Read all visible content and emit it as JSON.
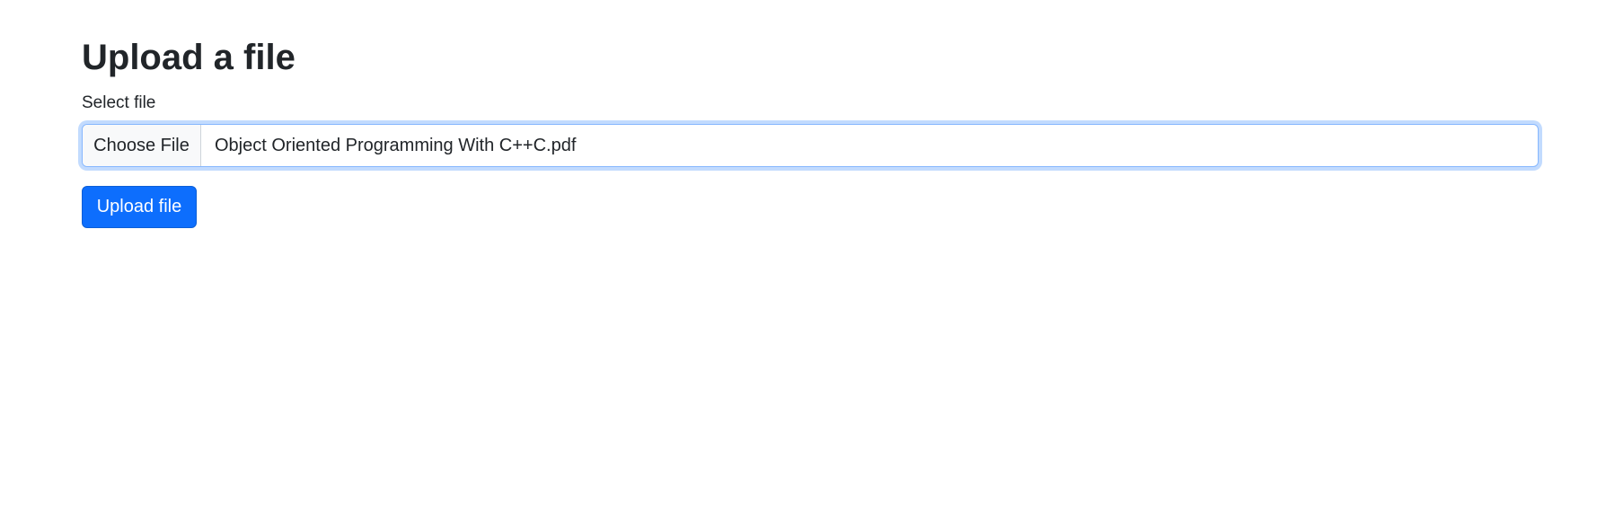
{
  "page": {
    "title": "Upload a file"
  },
  "form": {
    "label": "Select file",
    "choose_button_label": "Choose File",
    "selected_file_name": "Object Oriented Programming With C++C.pdf",
    "submit_label": "Upload file"
  },
  "colors": {
    "primary": "#0d6efd",
    "focus_border": "#86b7fe",
    "text": "#212529"
  }
}
